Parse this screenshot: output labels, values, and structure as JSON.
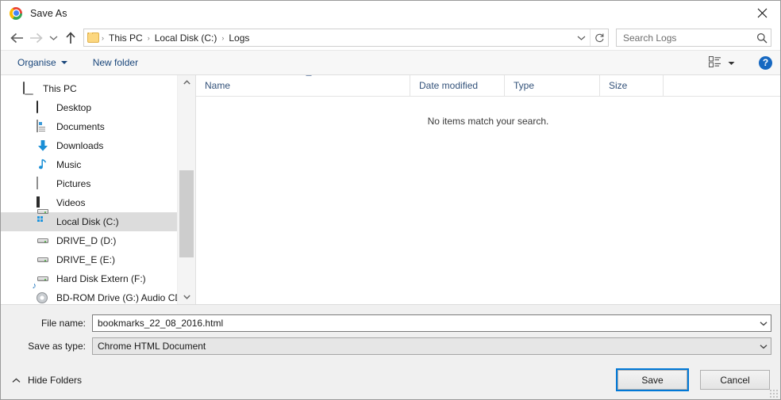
{
  "window": {
    "title": "Save As",
    "app_icon": "chrome-logo-icon",
    "close_label": "✕"
  },
  "nav": {
    "back_icon": "arrow-left-icon",
    "forward_icon": "arrow-right-icon",
    "recent_icon": "chevron-down-icon",
    "up_icon": "arrow-up-icon",
    "breadcrumbs": [
      "This PC",
      "Local Disk (C:)",
      "Logs"
    ],
    "separator": "›",
    "dropdown_icon": "chevron-down-icon",
    "refresh_icon": "refresh-icon"
  },
  "search": {
    "placeholder": "Search Logs",
    "value": "",
    "icon": "search-icon"
  },
  "commandbar": {
    "organise_label": "Organise",
    "new_folder_label": "New folder",
    "view_icon": "list-view-icon",
    "view_dropdown_icon": "chevron-down-icon",
    "help_label": "?"
  },
  "sidebar": {
    "items": [
      {
        "label": "This PC",
        "icon": "computer-icon",
        "level": "root",
        "selected": false
      },
      {
        "label": "Desktop",
        "icon": "desktop-icon",
        "level": "child",
        "selected": false
      },
      {
        "label": "Documents",
        "icon": "documents-icon",
        "level": "child",
        "selected": false
      },
      {
        "label": "Downloads",
        "icon": "downloads-icon",
        "level": "child",
        "selected": false
      },
      {
        "label": "Music",
        "icon": "music-icon",
        "level": "child",
        "selected": false
      },
      {
        "label": "Pictures",
        "icon": "pictures-icon",
        "level": "child",
        "selected": false
      },
      {
        "label": "Videos",
        "icon": "videos-icon",
        "level": "child",
        "selected": false
      },
      {
        "label": "Local Disk (C:)",
        "icon": "local-disk-icon",
        "level": "child",
        "selected": true
      },
      {
        "label": "DRIVE_D (D:)",
        "icon": "drive-icon",
        "level": "child",
        "selected": false
      },
      {
        "label": "DRIVE_E (E:)",
        "icon": "drive-icon",
        "level": "child",
        "selected": false
      },
      {
        "label": "Hard Disk Extern (F:)",
        "icon": "drive-icon",
        "level": "child",
        "selected": false
      },
      {
        "label": "BD-ROM Drive (G:) Audio CD",
        "icon": "bd-rom-icon",
        "level": "child",
        "selected": false
      }
    ],
    "scroll_up_icon": "chevron-up-icon",
    "scroll_down_icon": "chevron-down-icon"
  },
  "filelist": {
    "columns": [
      {
        "key": "name",
        "label": "Name"
      },
      {
        "key": "date",
        "label": "Date modified"
      },
      {
        "key": "type",
        "label": "Type"
      },
      {
        "key": "size",
        "label": "Size"
      }
    ],
    "sort_indicator": "ascending",
    "rows": [],
    "empty_message": "No items match your search."
  },
  "form": {
    "file_name_label": "File name:",
    "file_name_value": "bookmarks_22_08_2016.html",
    "save_as_type_label": "Save as type:",
    "save_as_type_value": "Chrome HTML Document",
    "dropdown_icon": "chevron-down-icon"
  },
  "actions": {
    "hide_folders_label": "Hide Folders",
    "hide_folders_icon": "chevron-up-icon",
    "save_label": "Save",
    "cancel_label": "Cancel"
  },
  "colors": {
    "accent": "#0078d7",
    "command_link": "#18457a",
    "column_header_text": "#33527a",
    "selected_row": "#dcdcdc",
    "footer_bg": "#f0f0f0",
    "help_blue": "#1668c1"
  }
}
